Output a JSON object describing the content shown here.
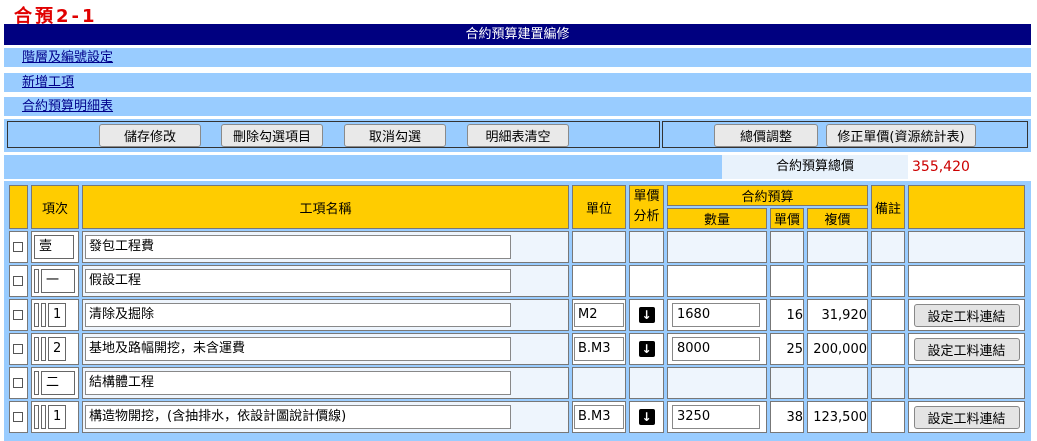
{
  "page_code": "合預2-1",
  "title": "合約預算建置編修",
  "nav": {
    "levels": "階層及編號設定",
    "add_item": "新增工項",
    "detail_table": "合約預算明細表"
  },
  "toolbar": {
    "save": "儲存修改",
    "delete_checked": "刪除勾選項目",
    "uncheck": "取消勾選",
    "clear_detail": "明細表清空",
    "adjust_total": "總價調整",
    "fix_unit_price": "修正單價(資源統計表)"
  },
  "summary": {
    "label": "合約預算總價",
    "value": "355,420"
  },
  "table": {
    "headers": {
      "item_no": "項次",
      "item_name": "工項名稱",
      "unit": "單位",
      "price_analysis_1": "單價",
      "price_analysis_2": "分析",
      "budget": "合約預算",
      "qty": "數量",
      "unit_price": "單價",
      "amount": "複價",
      "note": "備註"
    },
    "link_button_label": "設定工料連結",
    "rows": [
      {
        "level": 0,
        "no": "壹",
        "name": "發包工程費",
        "unit": "",
        "qty": "",
        "price": "",
        "amount": "",
        "has_link": false
      },
      {
        "level": 1,
        "no": "一",
        "name": "假設工程",
        "unit": "",
        "qty": "",
        "price": "",
        "amount": "",
        "has_link": false
      },
      {
        "level": 2,
        "no": "1",
        "name": "清除及掘除",
        "unit": "M2",
        "qty": "1680",
        "price": "16",
        "amount": "31,920",
        "has_link": true
      },
      {
        "level": 2,
        "no": "2",
        "name": "基地及路幅開挖，未含運費",
        "unit": "B.M3",
        "qty": "8000",
        "price": "25",
        "amount": "200,000",
        "has_link": true
      },
      {
        "level": 1,
        "no": "二",
        "name": "結構體工程",
        "unit": "",
        "qty": "",
        "price": "",
        "amount": "",
        "has_link": false
      },
      {
        "level": 2,
        "no": "1",
        "name": "構造物開挖，(含抽排水，依設計圖說計價線)",
        "unit": "B.M3",
        "qty": "3250",
        "price": "38",
        "amount": "123,500",
        "has_link": true
      }
    ]
  }
}
